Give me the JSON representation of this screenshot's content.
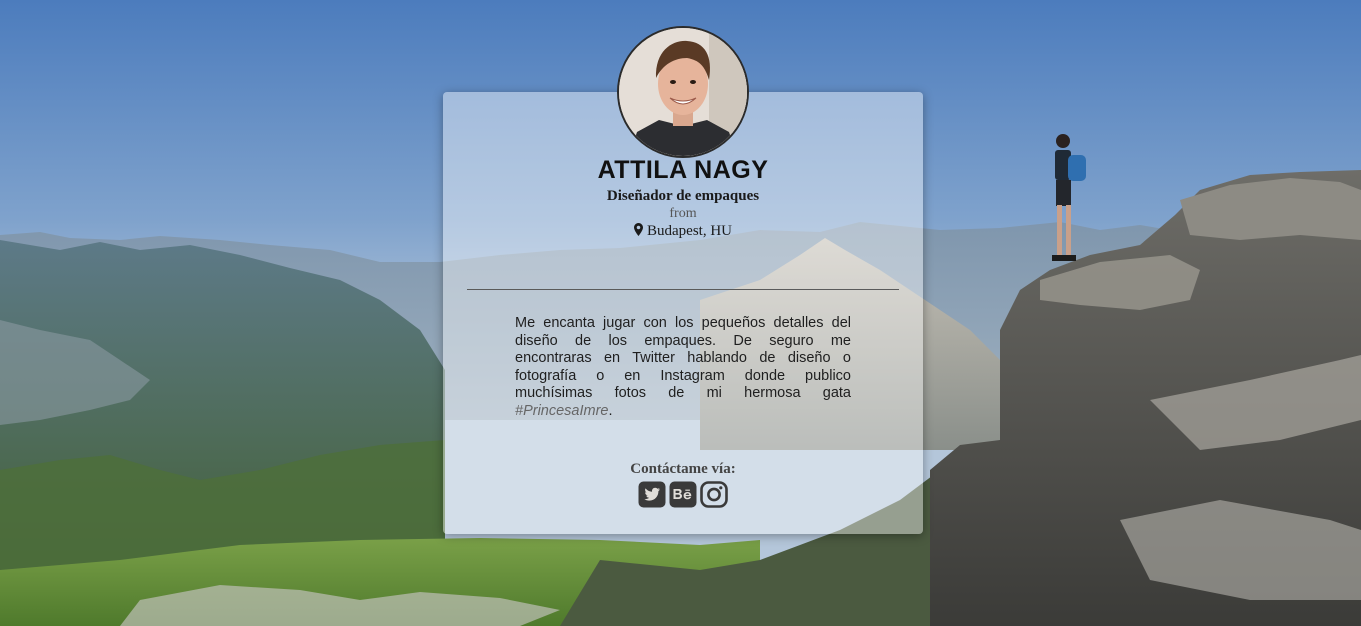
{
  "profile": {
    "name": "ATTILA NAGY",
    "role": "Diseñador de empaques",
    "from_label": "from",
    "location": "Budapest, HU",
    "bio_text": "Me encanta jugar con los pequeños detalles del diseño de los empaques. De seguro me encontraras en Twitter hablando de diseño o fotografía o en Instagram donde publico muchísimas fotos de mi hermosa gata",
    "bio_hashtag": "#PrincesaImre",
    "bio_end": "."
  },
  "contact": {
    "label": "Contáctame vía:",
    "links": [
      {
        "name": "twitter",
        "icon": "twitter-icon"
      },
      {
        "name": "behance",
        "icon": "behance-icon"
      },
      {
        "name": "instagram",
        "icon": "instagram-icon"
      }
    ]
  },
  "colors": {
    "card_overlay": "rgba(255,255,255,0.42)",
    "icon_color": "#3a3a3a",
    "divider": "#5a5a5a"
  }
}
